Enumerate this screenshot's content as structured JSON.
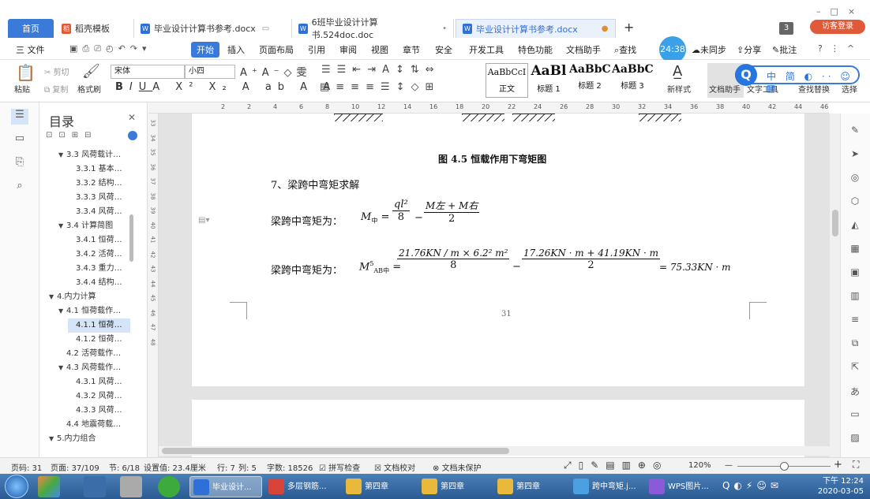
{
  "tabs": {
    "home": "首页",
    "items": [
      {
        "label": "稻壳模板"
      },
      {
        "label": "毕业设计计算书参考.docx"
      },
      {
        "label": "6班毕业设计计算书.524doc.doc"
      },
      {
        "label": "毕业设计计算书参考.docx"
      }
    ],
    "window_count": "3",
    "login": "访客登录"
  },
  "menu": {
    "file": "三 文件",
    "items": [
      "开始",
      "插入",
      "页面布局",
      "引用",
      "审阅",
      "视图",
      "章节",
      "安全",
      "开发工具",
      "特色功能",
      "文档助手"
    ],
    "search": "查找",
    "clock": "24:38",
    "right": [
      "未同步",
      "分享",
      "批注"
    ]
  },
  "ribbon": {
    "paste": "粘贴",
    "cut": "剪切",
    "copy": "复制",
    "format_painter": "格式刷",
    "font_name": "宋体",
    "font_size": "小四",
    "styles": [
      {
        "sample": "AaBbCcI",
        "label": "正文"
      },
      {
        "sample": "AaBl",
        "label": "标题 1"
      },
      {
        "sample": "AaBbC",
        "label": "标题 2"
      },
      {
        "sample": "AaBbC",
        "label": "标题 3"
      }
    ],
    "new_style": "新样式",
    "doc_assist": "文档助手",
    "text_tools": "文字工具",
    "find_replace": "查找替换",
    "select": "选择",
    "ime": "中 简 ◐ ·· ☺ ▦"
  },
  "outline": {
    "title": "目录",
    "items": [
      {
        "label": "3.3 风荷载计…",
        "level": 2,
        "expand": "▼"
      },
      {
        "label": "3.3.1 基本…",
        "level": 3
      },
      {
        "label": "3.3.2 结构…",
        "level": 3
      },
      {
        "label": "3.3.3 风荷…",
        "level": 3
      },
      {
        "label": "3.3.4 风荷…",
        "level": 3
      },
      {
        "label": "3.4 计算简图",
        "level": 2,
        "expand": "▼"
      },
      {
        "label": "3.4.1 恒荷…",
        "level": 3
      },
      {
        "label": "3.4.2 活荷…",
        "level": 3
      },
      {
        "label": "3.4.3 重力…",
        "level": 3
      },
      {
        "label": "3.4.4 结构…",
        "level": 3
      },
      {
        "label": "4.内力计算",
        "level": 1,
        "expand": "▼"
      },
      {
        "label": "4.1 恒荷载作…",
        "level": 2,
        "expand": "▼"
      },
      {
        "label": "4.1.1 恒荷…",
        "level": 3,
        "selected": true
      },
      {
        "label": "4.1.2 恒荷…",
        "level": 3
      },
      {
        "label": "4.2 活荷载作…",
        "level": 2
      },
      {
        "label": "4.3 风荷载作…",
        "level": 2,
        "expand": "▼"
      },
      {
        "label": "4.3.1 风荷…",
        "level": 3
      },
      {
        "label": "4.3.2 风荷…",
        "level": 3
      },
      {
        "label": "4.3.3 风荷…",
        "level": 3
      },
      {
        "label": "4.4 地震荷载…",
        "level": 2
      },
      {
        "label": "5.内力组合",
        "level": 1,
        "expand": "▼"
      }
    ]
  },
  "ruler": {
    "h_ticks": [
      "2",
      "2",
      "4",
      "6",
      "8",
      "10",
      "12",
      "14",
      "16",
      "18",
      "20",
      "22",
      "24",
      "26",
      "28",
      "30",
      "32",
      "34",
      "36",
      "38",
      "40",
      "42",
      "44",
      "46"
    ],
    "v_ticks": [
      "33",
      "34",
      "35",
      "36",
      "37",
      "38",
      "39",
      "40",
      "41",
      "42",
      "43",
      "44",
      "45",
      "46",
      "47",
      "48"
    ]
  },
  "document": {
    "caption": "图 4.5  恒载作用下弯矩图",
    "heading": "7、梁跨中弯矩求解",
    "formula1_label": "梁跨中弯矩为：",
    "formula1_lhs": "M",
    "formula1_lhs_sub": "中",
    "formula1_num1": "ql²",
    "formula1_den1": "8",
    "formula1_num2": "M左 + M右",
    "formula1_den2": "2",
    "formula2_label": "梁跨中弯矩为：",
    "formula2_lhs": "M",
    "formula2_lhs_sup": "5",
    "formula2_lhs_sub": "AB中",
    "formula2_num1": "21.76KN / m × 6.2² m²",
    "formula2_den1": "8",
    "formula2_num2": "17.26KN · m + 41.19KN · m",
    "formula2_den2": "2",
    "formula2_result": "= 75.33KN · m",
    "page_number": "31"
  },
  "status": {
    "page": "页码: 31",
    "page_of": "页面: 37/109",
    "section": "节: 6/18",
    "setting": "设置值: 23.4厘米",
    "line": "行: 7",
    "col": "列: 5",
    "words": "字数: 18526",
    "spell": "拼写检查",
    "proof": "文档校对",
    "protect": "文档未保护",
    "zoom": "120%"
  },
  "taskbar": {
    "items": [
      {
        "label": "毕业设计...",
        "active": true,
        "color": "#2e6fd8"
      },
      {
        "label": "多层钢筋...",
        "color": "#d9443a"
      },
      {
        "label": "第四章",
        "color": "#e8b93a"
      },
      {
        "label": "第四章",
        "color": "#e8b93a"
      },
      {
        "label": "第四章",
        "color": "#e8b93a"
      },
      {
        "label": "跨中弯矩.j...",
        "color": "#4aa0e0"
      },
      {
        "label": "WPS图片...",
        "color": "#8a5ad8"
      }
    ],
    "time": "下午 12:24",
    "date": "2020-03-05"
  }
}
